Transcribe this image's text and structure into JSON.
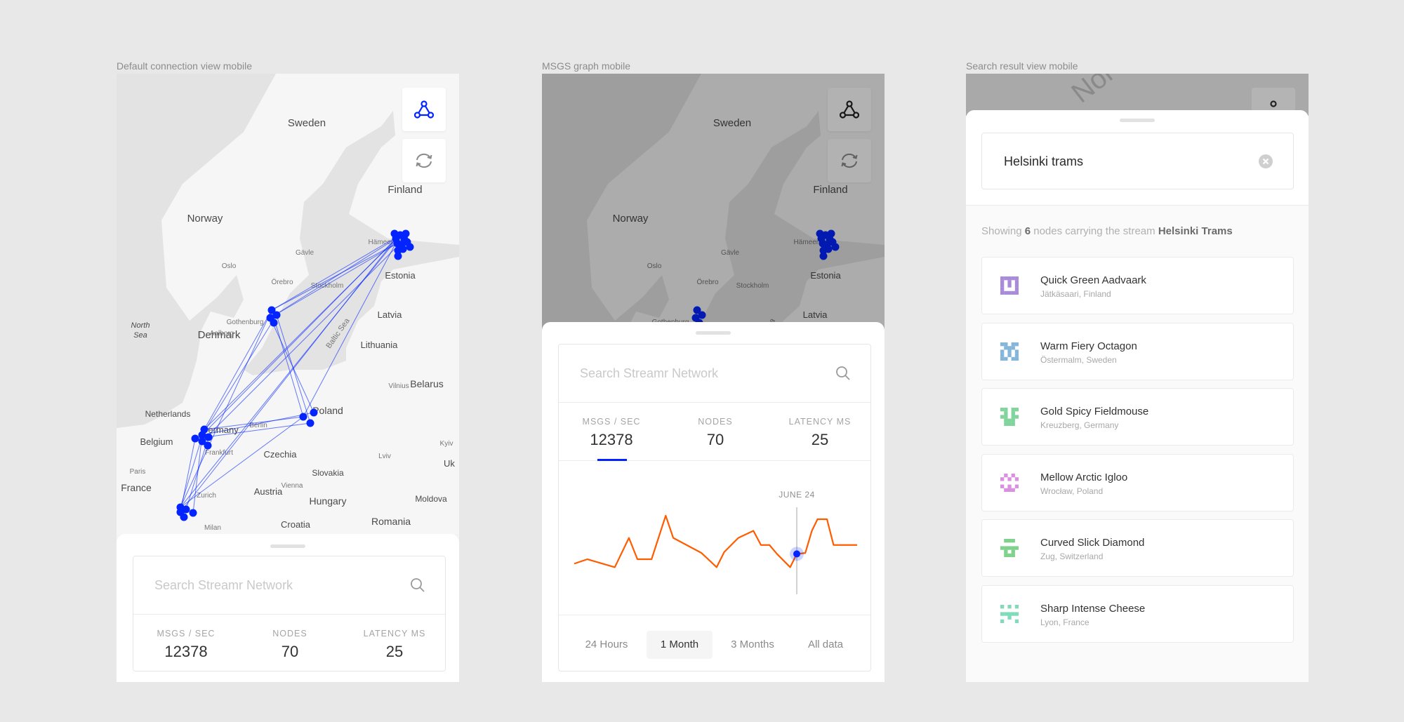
{
  "captions": [
    "Default connection view mobile",
    "MSGS graph mobile",
    "Search result view mobile"
  ],
  "colors": {
    "accent": "#0324ff",
    "chart_line": "#ff5c00",
    "text": "#323232",
    "muted": "#a5a5a5"
  },
  "map": {
    "labels": [
      "Sweden",
      "Norway",
      "Finland",
      "Denmark",
      "Estonia",
      "Latvia",
      "Lithuania",
      "Belarus",
      "Netherlands",
      "Germany",
      "Poland",
      "Belgium",
      "Czechia",
      "France",
      "Slovakia",
      "Austria",
      "Hungary",
      "Romania",
      "Moldova",
      "Croatia",
      "North",
      "Sea",
      "Uk"
    ],
    "cities": [
      "Oslo",
      "Stockholm",
      "Gothenburg",
      "Aalborg",
      "Örebro",
      "Gävle",
      "Hämeenlinna",
      "Berlin",
      "Frankfurt",
      "Vienna",
      "Zurich",
      "Milan",
      "Paris",
      "Vilnius",
      "Kyiv",
      "Lviv",
      "Baltic Sea"
    ],
    "buttons": {
      "topology_icon": "network-triangle-icon",
      "refresh_icon": "refresh-icon"
    }
  },
  "search": {
    "placeholder": "Search Streamr Network",
    "icon": "search-icon"
  },
  "stats": [
    {
      "label": "MSGS / SEC",
      "value": "12378"
    },
    {
      "label": "NODES",
      "value": "70"
    },
    {
      "label": "LATENCY MS",
      "value": "25"
    }
  ],
  "chart_data": {
    "type": "line",
    "title": "",
    "x": [
      0,
      1.4,
      4.3,
      5.8,
      6.7,
      8.2,
      9.7,
      10.5,
      13.5,
      15.1,
      15.9,
      17.4,
      19,
      19.8,
      20.7,
      21.5,
      22.9,
      23.6,
      24.5,
      25.2,
      25.8,
      26.8,
      27.5,
      30
    ],
    "values": [
      35,
      40,
      31,
      64,
      40,
      40,
      89,
      64,
      47,
      31,
      48,
      64,
      72,
      56,
      56,
      46,
      31,
      46,
      47,
      72,
      85,
      85,
      56,
      56
    ],
    "xlim": [
      0,
      30
    ],
    "ylim": [
      0,
      100
    ],
    "grid": false,
    "highlight": {
      "index": 17,
      "label": "JUNE 24"
    }
  },
  "time_tabs": [
    {
      "label": "24 Hours",
      "selected": false
    },
    {
      "label": "1 Month",
      "selected": true
    },
    {
      "label": "3 Months",
      "selected": false
    },
    {
      "label": "All data",
      "selected": false
    }
  ],
  "search_result": {
    "query": "Helsinki trams",
    "clear_icon": "clear-circle-icon",
    "summary_prefix": "Showing ",
    "summary_count": "6",
    "summary_middle": " nodes carrying the stream ",
    "summary_stream": "Helsinki Trams",
    "map_label": "Norway",
    "nodes": [
      {
        "name": "Quick Green Aadvaark",
        "location": "Jätkäsaari, Finland",
        "color": "#a98bd9"
      },
      {
        "name": "Warm Fiery Octagon",
        "location": "Östermalm, Sweden",
        "color": "#84b6dc"
      },
      {
        "name": "Gold Spicy Fieldmouse",
        "location": "Kreuzberg, Germany",
        "color": "#80d49c"
      },
      {
        "name": "Mellow Arctic Igloo",
        "location": "Wrocław, Poland",
        "color": "#db8fe0"
      },
      {
        "name": "Curved Slick Diamond",
        "location": "Zug, Switzerland",
        "color": "#80d18c"
      },
      {
        "name": "Sharp Intense Cheese",
        "location": "Lyon, France",
        "color": "#7fdbb9"
      }
    ]
  }
}
